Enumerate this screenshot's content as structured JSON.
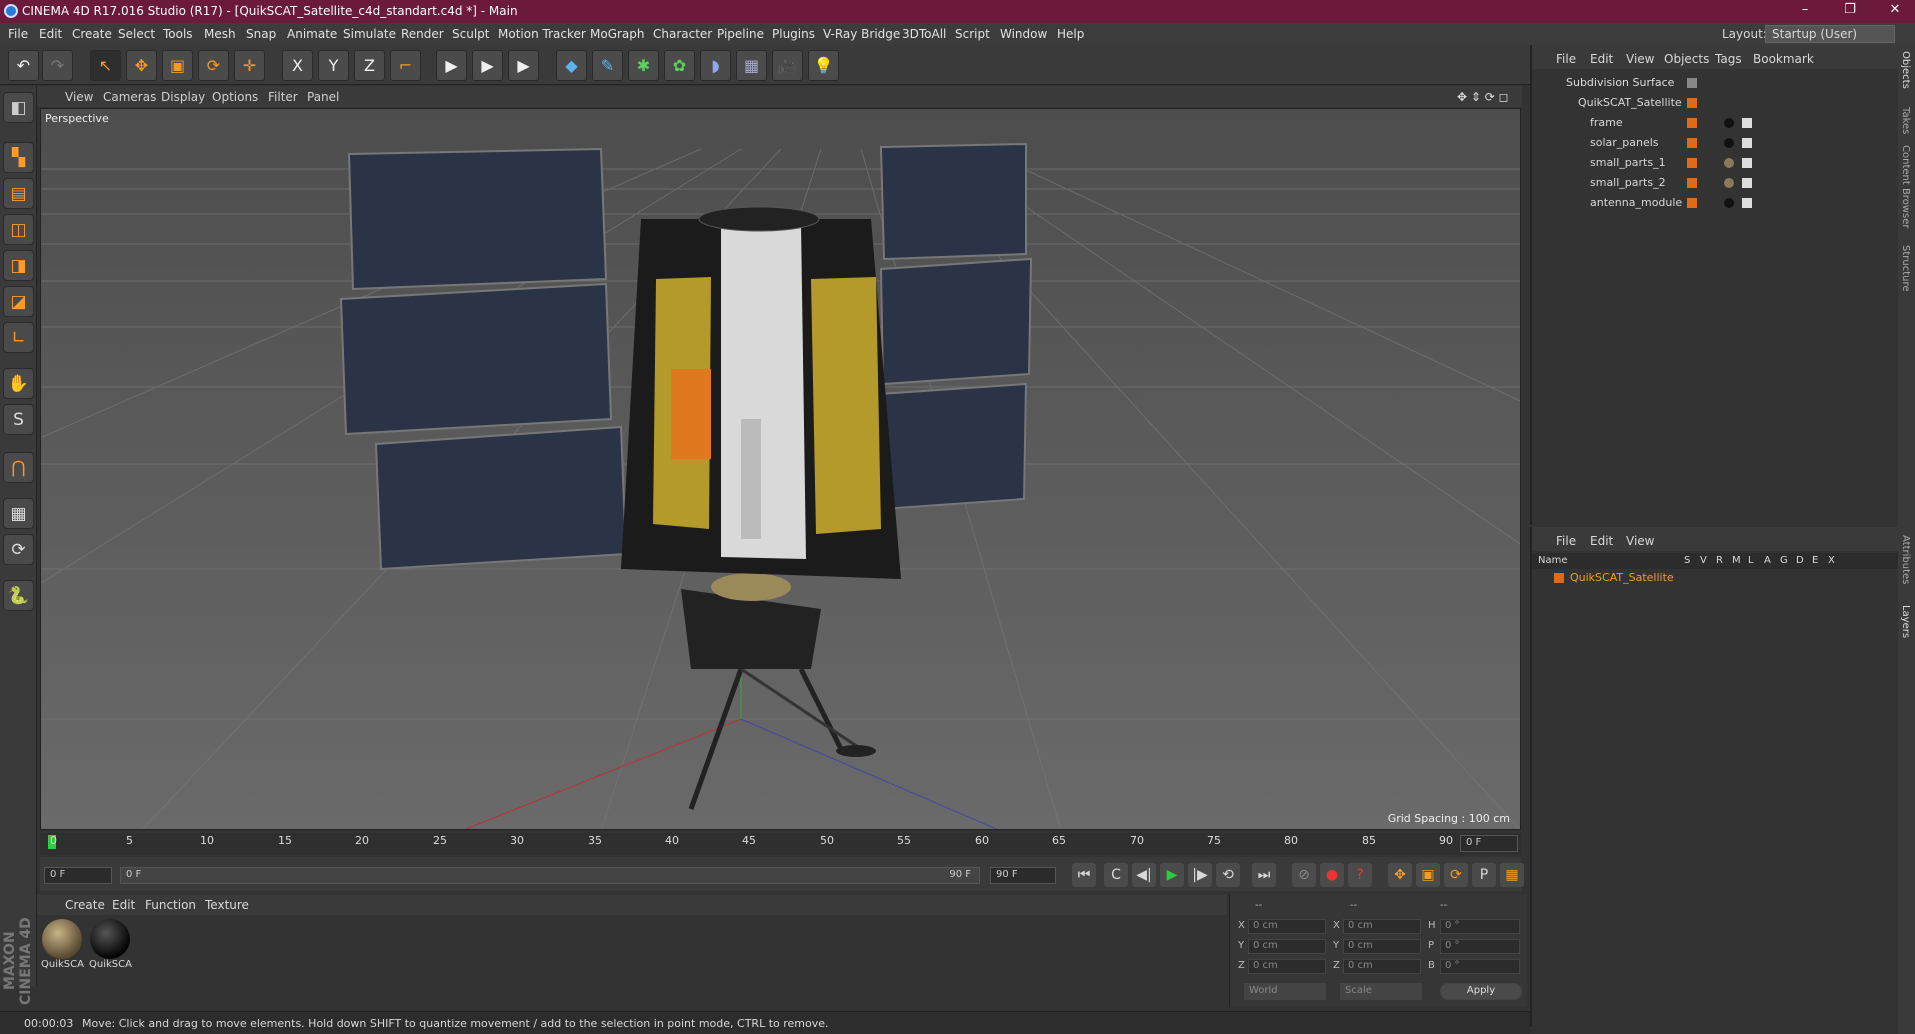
{
  "window": {
    "title": "CINEMA 4D R17.016 Studio (R17) - [QuikSCAT_Satellite_c4d_standart.c4d *] - Main",
    "min": "–",
    "max": "❐",
    "close": "✕"
  },
  "menu": [
    "File",
    "Edit",
    "Create",
    "Select",
    "Tools",
    "Mesh",
    "Snap",
    "Animate",
    "Simulate",
    "Render",
    "Sculpt",
    "Motion Tracker",
    "MoGraph",
    "Character",
    "Pipeline",
    "Plugins",
    "V-Ray Bridge",
    "3DToAll",
    "Script",
    "Window",
    "Help"
  ],
  "layout": {
    "label": "Layout:",
    "value": "Startup (User)"
  },
  "toolbar": {
    "undo": "↶",
    "redo": "↷",
    "select": "↖",
    "move": "✥",
    "scale": "▣",
    "rotate": "⟳",
    "transform": "✛",
    "x": "X",
    "y": "Y",
    "z": "Z",
    "coord": "⌐",
    "render1": "▶",
    "render2": "▶",
    "render3": "▶",
    "cube": "◆",
    "pen": "✎",
    "subdiv": "✱",
    "mograph": "✿",
    "deform": "◗",
    "floor": "▦",
    "camera": "🎥",
    "light": "💡"
  },
  "lefttools": [
    "◧",
    "▚",
    "▤",
    "◫",
    "◨",
    "◪",
    "∟",
    "✋",
    "S",
    "⋂",
    "▦",
    "⟳",
    "🐍"
  ],
  "viewport": {
    "menu": [
      "View",
      "Cameras",
      "Display",
      "Options",
      "Filter",
      "Panel"
    ],
    "label": "Perspective",
    "grid_spacing": "Grid Spacing : 100 cm",
    "nav": "✥ ⇕ ⟳ ◻"
  },
  "timeline": {
    "ticks": [
      "0",
      "5",
      "10",
      "15",
      "20",
      "25",
      "30",
      "35",
      "40",
      "45",
      "50",
      "55",
      "60",
      "65",
      "70",
      "75",
      "80",
      "85",
      "90"
    ],
    "current": "0 F",
    "start": "0 F",
    "range_start": "0 F",
    "range_end": "90 F",
    "end": "90 F"
  },
  "playback": {
    "first": "⏮",
    "prev_key": "C",
    "prev": "◀|",
    "play": "▶",
    "next": "|▶",
    "loop": "⟲",
    "last": "⏭",
    "rec1": "⊘",
    "rec2": "●",
    "rec3": "?",
    "k1": "✥",
    "k2": "▣",
    "k3": "⟳",
    "k4": "P",
    "k5": "⋮⋮",
    "k6": "▦"
  },
  "materials": {
    "menu": [
      "Create",
      "Edit",
      "Function",
      "Texture"
    ],
    "items": [
      {
        "label": "QuikSCA"
      },
      {
        "label": "QuikSCA"
      }
    ]
  },
  "coords": {
    "header": [
      "--",
      "--",
      "--"
    ],
    "rows": [
      {
        "a": "X",
        "av": "0 cm",
        "b": "X",
        "bv": "0 cm",
        "c": "H",
        "cv": "0 °"
      },
      {
        "a": "Y",
        "av": "0 cm",
        "b": "Y",
        "bv": "0 cm",
        "c": "P",
        "cv": "0 °"
      },
      {
        "a": "Z",
        "av": "0 cm",
        "b": "Z",
        "bv": "0 cm",
        "c": "B",
        "cv": "0 °"
      }
    ],
    "world": "World",
    "scale": "Scale",
    "apply": "Apply"
  },
  "status": {
    "time": "00:00:03",
    "message": "Move: Click and drag to move elements. Hold down SHIFT to quantize movement / add to the selection in point mode, CTRL to remove."
  },
  "objects": {
    "menu": [
      "File",
      "Edit",
      "View",
      "Objects",
      "Tags",
      "Bookmark"
    ],
    "rows": [
      {
        "name": "Subdivision Surface",
        "indent": 0
      },
      {
        "name": "QuikSCAT_Satellite",
        "indent": 1
      },
      {
        "name": "frame",
        "indent": 2
      },
      {
        "name": "solar_panels",
        "indent": 2
      },
      {
        "name": "small_parts_1",
        "indent": 2
      },
      {
        "name": "small_parts_2",
        "indent": 2
      },
      {
        "name": "antenna_module",
        "indent": 2
      }
    ]
  },
  "layers": {
    "menu": [
      "File",
      "Edit",
      "View"
    ],
    "cols": [
      "Name",
      "S",
      "V",
      "R",
      "M",
      "L",
      "A",
      "G",
      "D",
      "E",
      "X"
    ],
    "row": "QuikSCAT_Satellite"
  },
  "sidetabs": [
    "Objects",
    "Takes",
    "Content Browser",
    "Structure",
    "Attributes",
    "Layers"
  ],
  "maxon": "MAXON CINEMA 4D",
  "colors": {
    "accent": "#f39c24",
    "title": "#6b1a3c",
    "panel": "#f29a1e",
    "object": "#e06a1a"
  }
}
